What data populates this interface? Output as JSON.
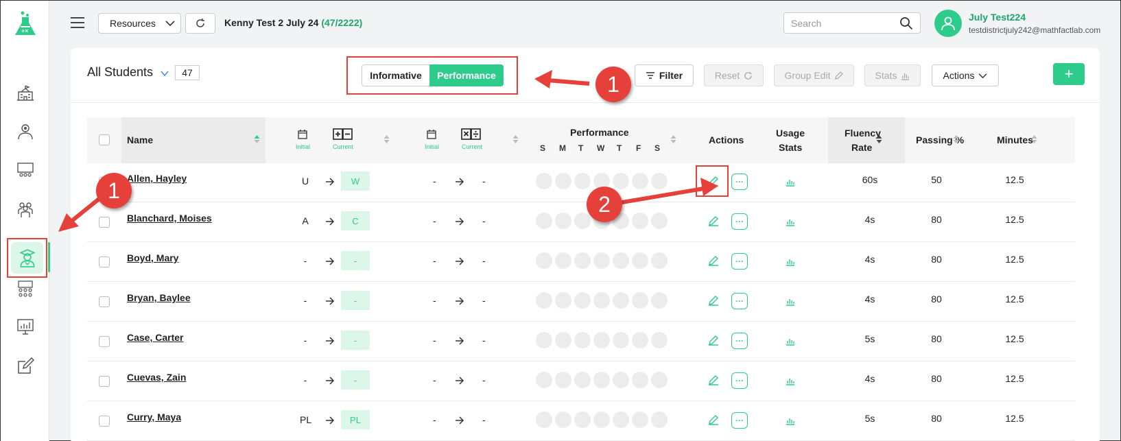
{
  "header": {
    "resources_label": "Resources",
    "class_name": "Kenny Test 2 July 24",
    "class_count": "(47/2222)",
    "search_placeholder": "Search",
    "user_name": "July Test224",
    "user_email": "testdistrictjuly242@mathfactlab.com"
  },
  "toolbar": {
    "all_students": "All Students",
    "student_count": "47",
    "informative": "Informative",
    "performance": "Performance",
    "filter": "Filter",
    "reset": "Reset",
    "group_edit": "Group Edit",
    "stats": "Stats",
    "actions": "Actions",
    "add": "+"
  },
  "table": {
    "headers": {
      "name": "Name",
      "initial": "Initial",
      "current": "Current",
      "performance": "Performance",
      "actions": "Actions",
      "usage": "Usage",
      "stats": "Stats",
      "fluency": "Fluency",
      "rate": "Rate",
      "passing": "Passing %",
      "minutes": "Minutes"
    },
    "days": [
      "S",
      "M",
      "T",
      "W",
      "T",
      "F",
      "S"
    ],
    "rows": [
      {
        "name": "Allen, Hayley",
        "initial": "U",
        "current": "W",
        "op_initial": "-",
        "op_current": "-",
        "fluency": "60s",
        "passing": "50",
        "minutes": "12.5"
      },
      {
        "name": "Blanchard, Moises",
        "initial": "A",
        "current": "C",
        "op_initial": "-",
        "op_current": "-",
        "fluency": "4s",
        "passing": "80",
        "minutes": "12.5"
      },
      {
        "name": "Boyd, Mary",
        "initial": "-",
        "current": "-",
        "op_initial": "-",
        "op_current": "-",
        "fluency": "4s",
        "passing": "80",
        "minutes": "12.5"
      },
      {
        "name": "Bryan, Baylee",
        "initial": "-",
        "current": "-",
        "op_initial": "-",
        "op_current": "-",
        "fluency": "4s",
        "passing": "80",
        "minutes": "12.5"
      },
      {
        "name": "Case, Carter",
        "initial": "-",
        "current": "-",
        "op_initial": "-",
        "op_current": "-",
        "fluency": "5s",
        "passing": "80",
        "minutes": "12.5"
      },
      {
        "name": "Cuevas, Zain",
        "initial": "-",
        "current": "-",
        "op_initial": "-",
        "op_current": "-",
        "fluency": "4s",
        "passing": "80",
        "minutes": "12.5"
      },
      {
        "name": "Curry, Maya",
        "initial": "PL",
        "current": "PL",
        "op_initial": "-",
        "op_current": "-",
        "fluency": "5s",
        "passing": "80",
        "minutes": "12.5"
      }
    ]
  },
  "annotations": {
    "callout_1": "1",
    "callout_2": "2",
    "accent_color": "#e5413a",
    "brand_color": "#2ecc8a"
  }
}
